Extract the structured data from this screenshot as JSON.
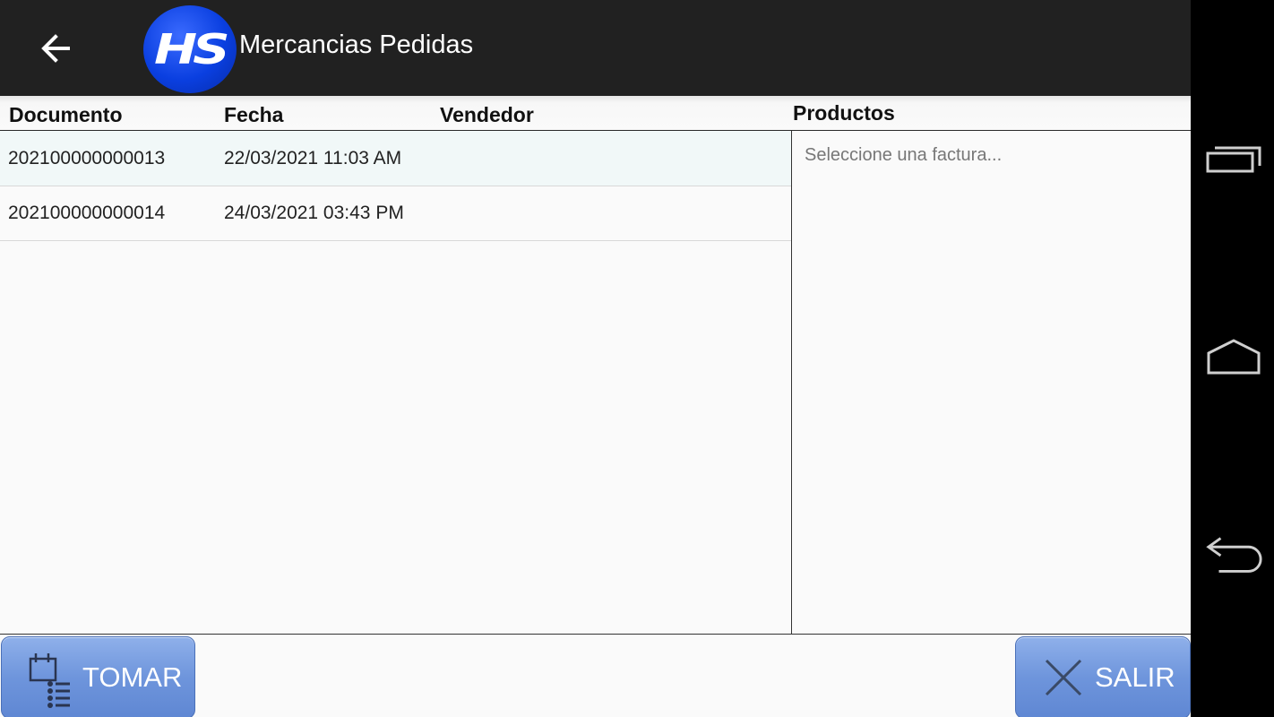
{
  "appbar": {
    "title": "Mercancias Pedidas",
    "logo_text": "HS"
  },
  "table": {
    "headers": {
      "documento": "Documento",
      "fecha": "Fecha",
      "vendedor": "Vendedor"
    },
    "rows": [
      {
        "documento": "202100000000013",
        "fecha": "22/03/2021 11:03 AM",
        "vendedor": ""
      },
      {
        "documento": "202100000000014",
        "fecha": "24/03/2021 03:43 PM",
        "vendedor": ""
      }
    ]
  },
  "products": {
    "header": "Productos",
    "placeholder": "Seleccione una factura..."
  },
  "buttons": {
    "tomar": "TOMAR",
    "salir": "SALIR"
  },
  "icons": {
    "back": "arrow-left-icon",
    "tomar": "calendar-list-icon",
    "salir": "close-x-icon",
    "nav_recent": "recent-apps-icon",
    "nav_home": "home-icon",
    "nav_back": "back-icon"
  },
  "colors": {
    "appbar": "#212121",
    "button": "#6e95dc",
    "logo": "#0a3fe0",
    "selected_row": "#f1f8f8"
  }
}
